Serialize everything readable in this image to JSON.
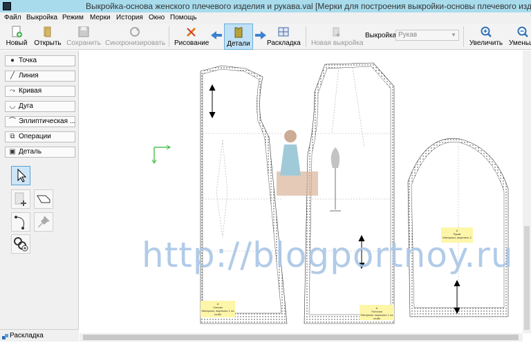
{
  "window": {
    "title": "Выкройка-основа женского плечевого изделия и рукава.val [Мерки для построения выкройки-основы плечевого изделия и р"
  },
  "menu": [
    "Файл",
    "Выкройка",
    "Режим",
    "Мерки",
    "История",
    "Окно",
    "Помощь"
  ],
  "toolbar": {
    "new": "Новый",
    "open": "Открыть",
    "save": "Сохранить",
    "sync": "Синхронизировать",
    "draw": "Рисование",
    "details": "Детали",
    "layout": "Раскладка",
    "new_pattern": "Новая выкройка",
    "pattern_label": "Выкройка:",
    "pattern_value": "Рукав",
    "zoom_in": "Увеличить",
    "zoom_out": "Уменьш"
  },
  "sidebar": {
    "items": [
      {
        "label": "Точка",
        "icon": "point-icon"
      },
      {
        "label": "Линия",
        "icon": "line-icon"
      },
      {
        "label": "Кривая",
        "icon": "curve-icon"
      },
      {
        "label": "Дуга",
        "icon": "arc-icon"
      },
      {
        "label": "Эллиптическая ...",
        "icon": "ellipse-icon"
      },
      {
        "label": "Операции",
        "icon": "operations-icon"
      },
      {
        "label": "Деталь",
        "icon": "detail-icon"
      }
    ],
    "bottom": "Раскладка"
  },
  "canvas": {
    "watermark": "http://blogportnoy.ru",
    "labels": [
      {
        "id": "back",
        "lines": [
          "А",
          "Спинка",
          "Материал, вырезать 1 на сгибе"
        ]
      },
      {
        "id": "front",
        "lines": [
          "А",
          "Полочка",
          "Материал, вырезать 1 на сгибе"
        ]
      },
      {
        "id": "sleeve",
        "lines": [
          "А",
          "Рукав",
          "Материал, вырезать 2"
        ]
      }
    ]
  },
  "colors": {
    "titlebar": "#a8dced",
    "accent": "#4a90d9",
    "label_bg": "#fdf6a8",
    "watermark": "#a9c6e6"
  }
}
